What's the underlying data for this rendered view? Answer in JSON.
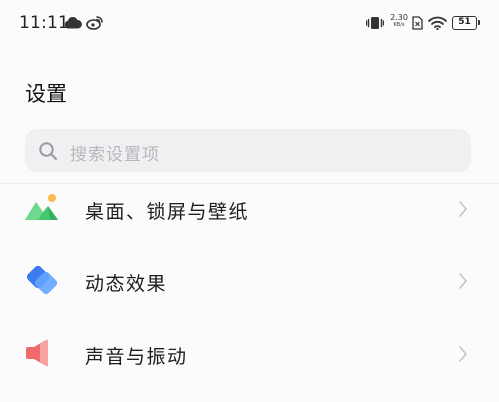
{
  "status_bar": {
    "time": "11:11",
    "net_speed_value": "2.30",
    "net_speed_unit": "KB/s",
    "battery_level": "51",
    "icons": [
      "cloud-icon",
      "weibo-icon",
      "vibrate-icon",
      "sim-icon",
      "wifi-icon",
      "battery-icon"
    ]
  },
  "header": {
    "title": "设置"
  },
  "search": {
    "placeholder": "搜索设置项"
  },
  "settings_list": [
    {
      "label": "桌面、锁屏与壁纸",
      "icon": "wallpaper-icon",
      "icon_colors": [
        "#5ad07a",
        "#ffb84d"
      ]
    },
    {
      "label": "动态效果",
      "icon": "dynamic-effect-icon",
      "icon_colors": [
        "#3a7bf0",
        "#64a4ff"
      ]
    },
    {
      "label": "声音与振动",
      "icon": "sound-icon",
      "icon_colors": [
        "#f06a6a",
        "#f8a2a2"
      ]
    }
  ],
  "colors": {
    "background": "#fbfbfc",
    "search_background": "#f0f0f2",
    "placeholder": "#b8b8bc",
    "chevron": "#c4c4c8"
  }
}
